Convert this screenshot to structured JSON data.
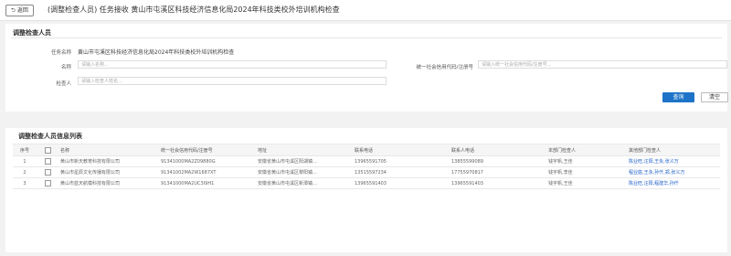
{
  "header": {
    "back_label": "返回",
    "back_icon": "arrow-left",
    "title": "(调整检查人员) 任务接收 黄山市屯溪区科技经济信息化局2024年科技类校外培训机构检查"
  },
  "form": {
    "section_title": "调整检查人员",
    "task_name_label": "任务名称",
    "task_name_value": "黄山市屯溪区科技经济信息化局2024年科技类校外培训机构检查",
    "name_label": "名称",
    "name_placeholder": "请输入名称...",
    "credit_label": "统一社会信用代码/注册号",
    "credit_placeholder": "请输入统一社会信用代码/注册号...",
    "inspector_label": "检查人",
    "inspector_placeholder": "请输入检查人姓名...",
    "query_label": "查询",
    "clear_label": "清空"
  },
  "list": {
    "title": "调整检查人员信息列表",
    "columns": [
      "序号",
      "",
      "名称",
      "统一社会信用代码/注册号",
      "地址",
      "联系电话",
      "联系人电话",
      "本部门检查人",
      "其他部门检查人"
    ],
    "rows": [
      [
        "1",
        "",
        "黄山市新天教育科技有限公司",
        "91341000MA2Z09880G",
        "安徽省黄山市屯溪区阳湖镇…",
        "13965591705",
        "13855599089",
        "钱宇帆,王佳",
        "陈业旺,汪阳,王永,张义万"
      ],
      [
        "2",
        "",
        "黄山市星辰文化传播有限公司",
        "91341002MA2W1687XT",
        "安徽省黄山市屯溪区黎阳镇…",
        "13515597234",
        "17755970817",
        "钱宇帆,李佳",
        "程业庭,王永,孙仟,郑,张义万"
      ],
      [
        "3",
        "",
        "黄山市蓝天航模科技有限公司",
        "91341000MA2UC3I9H1",
        "安徽省黄山市屯溪区新潭镇…",
        "13965591403",
        "13965591403",
        "钱宇帆,王佳",
        "陈业旺,汪阳,程建华,孙仟"
      ]
    ]
  },
  "colors": {
    "primary": "#1e73c8",
    "link": "#1e5fc8",
    "background": "#f2f2f2"
  }
}
